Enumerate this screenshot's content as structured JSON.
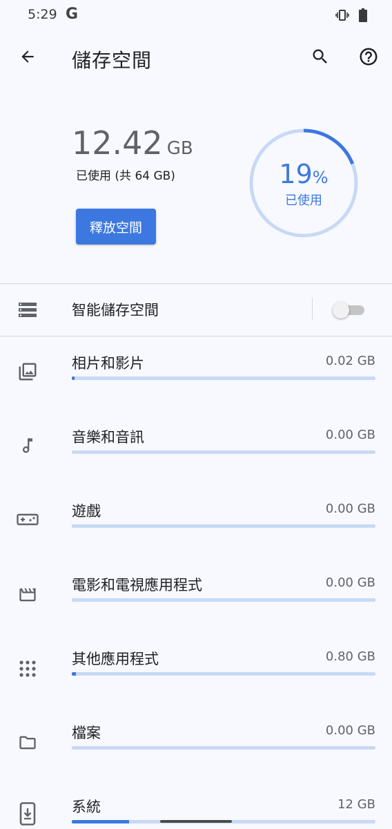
{
  "status_bar": {
    "time": "5:29",
    "g_logo": "G",
    "icons": [
      "vibrate-icon",
      "battery-icon"
    ]
  },
  "app_bar": {
    "title": "儲存空間",
    "icons": [
      "back-arrow-icon",
      "search-icon",
      "help-icon"
    ]
  },
  "summary": {
    "used_value": "12.42",
    "used_unit": "GB",
    "used_sub": "已使用 (共 64 GB)",
    "free_button": "釋放空間",
    "ring_percent": "19",
    "ring_percent_sign": "%",
    "ring_label": "已使用",
    "ring_fraction": 0.19
  },
  "smart_storage": {
    "label": "智能儲存空間",
    "enabled": false,
    "icon": "storage-icon"
  },
  "categories": [
    {
      "label": "相片和影片",
      "size": "0.02 GB",
      "icon": "photo-icon",
      "fraction": 0.0003
    },
    {
      "label": "音樂和音訊",
      "size": "0.00 GB",
      "icon": "music-note-icon",
      "fraction": 0
    },
    {
      "label": "遊戲",
      "size": "0.00 GB",
      "icon": "gamepad-icon",
      "fraction": 0
    },
    {
      "label": "電影和電視應用程式",
      "size": "0.00 GB",
      "icon": "movie-icon",
      "fraction": 0
    },
    {
      "label": "其他應用程式",
      "size": "0.80 GB",
      "icon": "apps-grid-icon",
      "fraction": 0.0125
    },
    {
      "label": "檔案",
      "size": "0.00 GB",
      "icon": "folder-icon",
      "fraction": 0
    },
    {
      "label": "系統",
      "size": "12 GB",
      "icon": "system-update-icon",
      "fraction": 0.1875
    }
  ],
  "colors": {
    "accent": "#3c78e0",
    "track": "#c7d9f5",
    "background": "#f8f9fe"
  }
}
